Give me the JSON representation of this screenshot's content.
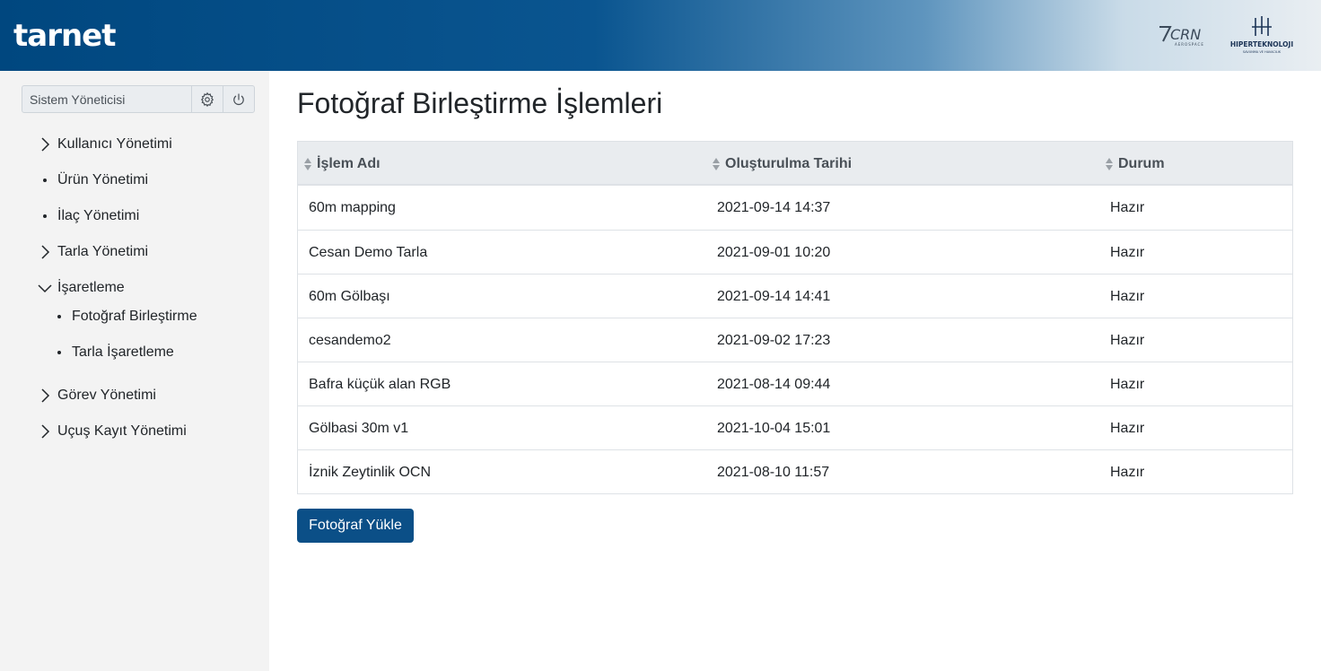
{
  "header": {
    "logo": "tarnet",
    "partners": [
      {
        "name": "CRN AEROSPACE",
        "text": "CRN",
        "sub": "AEROSPACE"
      },
      {
        "name": "HIPERTEKNOLOJI",
        "text": "HIPERTEKNOLOJI",
        "sub": "SAVUNMA VE HAVACILIK"
      }
    ]
  },
  "sidebar": {
    "user": "Sistem Yöneticisi",
    "settings_icon": "gear-icon",
    "logout_icon": "power-icon",
    "menu": [
      {
        "label": "Kullanıcı Yönetimi",
        "icon": "chevron-right-icon"
      },
      {
        "label": "Ürün Yönetimi",
        "icon": "bullet"
      },
      {
        "label": "İlaç Yönetimi",
        "icon": "bullet"
      },
      {
        "label": "Tarla Yönetimi",
        "icon": "chevron-right-icon"
      },
      {
        "label": "İşaretleme",
        "icon": "chevron-down-icon",
        "expanded": true,
        "children": [
          {
            "label": "Fotoğraf Birleştirme"
          },
          {
            "label": "Tarla İşaretleme"
          }
        ]
      },
      {
        "label": "Görev Yönetimi",
        "icon": "chevron-right-icon"
      },
      {
        "label": "Uçuş Kayıt Yönetimi",
        "icon": "chevron-right-icon"
      }
    ]
  },
  "main": {
    "title": "Fotoğraf Birleştirme İşlemleri",
    "table": {
      "columns": [
        "İşlem Adı",
        "Oluşturulma Tarihi",
        "Durum"
      ],
      "rows": [
        [
          "60m mapping",
          "2021-09-14 14:37",
          "Hazır"
        ],
        [
          "Cesan Demo Tarla",
          "2021-09-01 10:20",
          "Hazır"
        ],
        [
          "60m Gölbaşı",
          "2021-09-14 14:41",
          "Hazır"
        ],
        [
          "cesandemo2",
          "2021-09-02 17:23",
          "Hazır"
        ],
        [
          "Bafra küçük alan RGB",
          "2021-08-14 09:44",
          "Hazır"
        ],
        [
          "Gölbasi 30m v1",
          "2021-10-04 15:01",
          "Hazır"
        ],
        [
          "İznik Zeytinlik OCN",
          "2021-08-10 11:57",
          "Hazır"
        ]
      ]
    },
    "upload_button": "Fotoğraf Yükle"
  },
  "colors": {
    "brand": "#00477f",
    "button": "#0b4f87",
    "sidebar_bg": "#f3f3f3",
    "table_header_bg": "#e9ecef"
  }
}
